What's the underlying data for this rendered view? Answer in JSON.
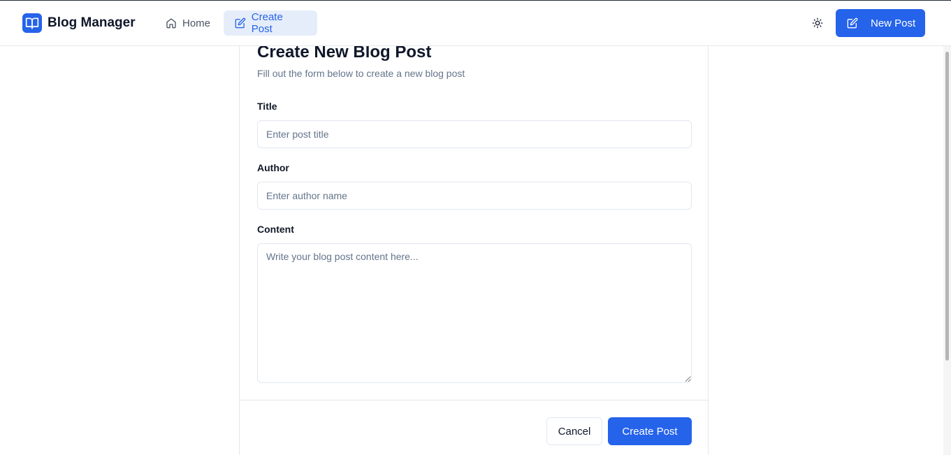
{
  "header": {
    "app_name": "Blog Manager",
    "nav": [
      {
        "label": "Home",
        "icon": "home-icon",
        "active": false
      },
      {
        "label": "Create Post",
        "icon": "edit-icon",
        "active": true
      }
    ],
    "theme_toggle_icon": "sun-icon",
    "new_post_label": "New Post"
  },
  "form": {
    "title": "Create New Blog Post",
    "subtitle": "Fill out the form below to create a new blog post",
    "fields": {
      "title": {
        "label": "Title",
        "placeholder": "Enter post title",
        "value": ""
      },
      "author": {
        "label": "Author",
        "placeholder": "Enter author name",
        "value": ""
      },
      "content": {
        "label": "Content",
        "placeholder": "Write your blog post content here...",
        "value": ""
      }
    },
    "cancel_label": "Cancel",
    "submit_label": "Create Post"
  },
  "colors": {
    "primary": "#2563eb",
    "active_nav_bg": "#e6edfa",
    "text": "#0f172a",
    "muted": "#64748b",
    "border": "#e2e8f0"
  }
}
